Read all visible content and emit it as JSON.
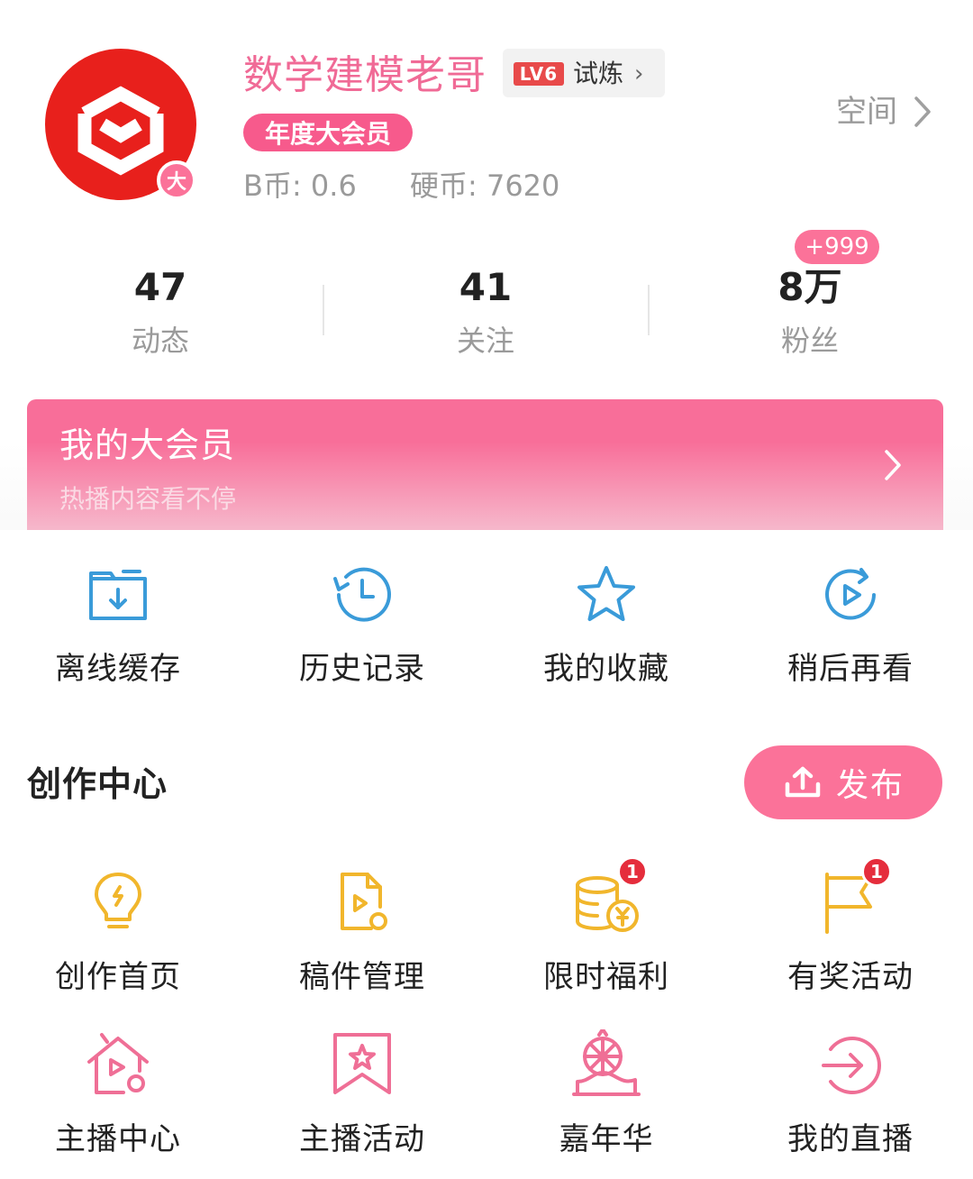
{
  "profile": {
    "username": "数学建模老哥",
    "avatar_badge": "大",
    "level_tag": "LV6",
    "level_text": "试炼",
    "vip_pill": "年度大会员",
    "b_coin": "B币: 0.6",
    "hard_coin": "硬币: 7620",
    "space_label": "空间"
  },
  "stats": {
    "posts": {
      "value": "47",
      "label": "动态"
    },
    "following": {
      "value": "41",
      "label": "关注"
    },
    "fans": {
      "value": "8万",
      "label": "粉丝",
      "badge": "+999"
    }
  },
  "vip_banner": {
    "title": "我的大会员",
    "subtitle": "热播内容看不停"
  },
  "quick_actions": [
    {
      "label": "离线缓存",
      "icon": "offline-cache-icon"
    },
    {
      "label": "历史记录",
      "icon": "history-icon"
    },
    {
      "label": "我的收藏",
      "icon": "favorites-star-icon"
    },
    {
      "label": "稍后再看",
      "icon": "watch-later-icon"
    }
  ],
  "creation_center": {
    "title": "创作中心",
    "publish_label": "发布",
    "items": [
      {
        "label": "创作首页",
        "icon": "creation-home-bulb-icon"
      },
      {
        "label": "稿件管理",
        "icon": "manuscript-manage-icon"
      },
      {
        "label": "限时福利",
        "icon": "coin-stack-icon",
        "badge": "1"
      },
      {
        "label": "有奖活动",
        "icon": "reward-flag-icon",
        "badge": "1"
      }
    ]
  },
  "live_items": [
    {
      "label": "主播中心",
      "icon": "streamer-center-icon"
    },
    {
      "label": "主播活动",
      "icon": "streamer-activity-icon"
    },
    {
      "label": "嘉年华",
      "icon": "carnival-icon"
    },
    {
      "label": "我的直播",
      "icon": "my-live-icon"
    }
  ],
  "colors": {
    "brand_pink": "#fb7299",
    "icon_blue": "#3a9bd9",
    "icon_yellow": "#f1b62c",
    "icon_pink": "#ef6f96",
    "avatar_red": "#e8201c"
  }
}
